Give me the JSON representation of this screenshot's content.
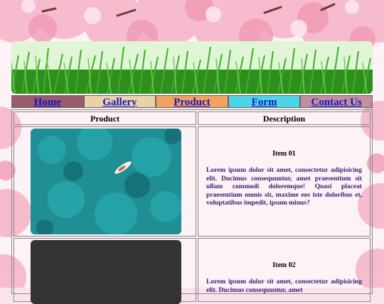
{
  "nav": {
    "items": [
      {
        "label": "Home",
        "bg": "#9a5b6a"
      },
      {
        "label": "Gallery",
        "bg": "#ead2a7"
      },
      {
        "label": "Product",
        "bg": "#f2a25f"
      },
      {
        "label": "Form",
        "bg": "#4fd3e6"
      },
      {
        "label": "Contact Us",
        "bg": "#c28f9c"
      }
    ]
  },
  "table": {
    "headers": [
      "Product",
      "Description"
    ],
    "rows": [
      {
        "title": "Item 01",
        "desc": "Lorem ipsum dolor sit amet, consectetur adipisicing elit. Ducimus consequuntur, amet praesentium sit ullam commodi doloremque! Quasi placeat praesentium omnis sit, maxime eos iste doloribus et, voluptatibus impedit, ipsum minus?"
      },
      {
        "title": "Item 02",
        "desc": "Lorem ipsum dolor sit amet, consectetur adipisicing elit. Ducimus consequuntur, amet"
      }
    ]
  },
  "colors": {
    "sakura": "#f6b6c9",
    "grass": "#3fae2a",
    "water": "#1f8e95",
    "link": "#1616c8",
    "desc": "#3d1a72"
  }
}
